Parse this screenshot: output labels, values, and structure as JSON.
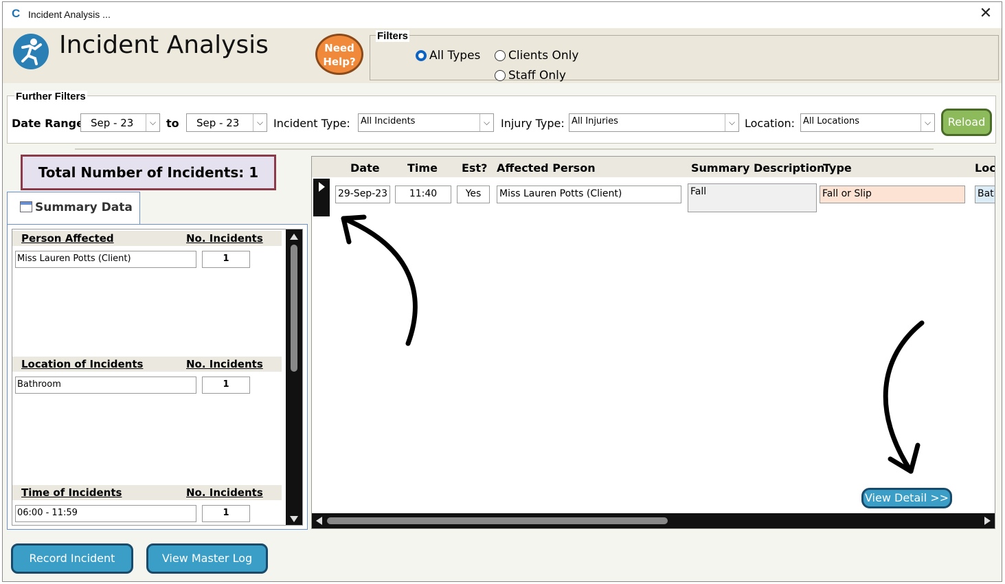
{
  "window": {
    "app_logo": "C",
    "title": "Incident Analysis ...",
    "close_glyph": "✕"
  },
  "header": {
    "icon": "person-falling-icon",
    "title": "Incident Analysis",
    "help_line1": "Need",
    "help_line2": "Help?"
  },
  "filters": {
    "legend": "Filters",
    "options": [
      {
        "label": "All Types",
        "selected": true
      },
      {
        "label": "Clients Only",
        "selected": false
      },
      {
        "label": "Staff Only",
        "selected": false
      }
    ]
  },
  "further_filters": {
    "legend": "Further Filters",
    "date_range_label": "Date Range:",
    "date_from": "Sep - 23",
    "to_label": "to",
    "date_to": "Sep - 23",
    "incident_type_label": "Incident Type:",
    "incident_type": "All Incidents",
    "injury_type_label": "Injury Type:",
    "injury_type": "All Injuries",
    "location_label": "Location:",
    "location": "All Locations",
    "dropdown_glyph": "⌵",
    "reload": "Reload"
  },
  "summary": {
    "total_label": "Total Number of Incidents: 1",
    "tab_label": "Summary Data",
    "sections": [
      {
        "heading": "Person Affected",
        "count_heading": "No. Incidents",
        "value": "Miss Lauren Potts (Client)",
        "count": "1"
      },
      {
        "heading": "Location of Incidents",
        "count_heading": "No. Incidents",
        "value": "Bathroom",
        "count": "1"
      },
      {
        "heading": "Time of Incidents",
        "count_heading": "No. Incidents",
        "value": "06:00 - 11:59",
        "count": "1"
      }
    ]
  },
  "grid": {
    "columns": [
      "Date",
      "Time",
      "Est?",
      "Affected Person",
      "Summary Description",
      "Type",
      "Loca"
    ],
    "rows": [
      {
        "date": "29-Sep-23",
        "time": "11:40",
        "est": "Yes",
        "person": "Miss Lauren Potts (Client)",
        "description": "Fall",
        "type": "Fall or Slip",
        "location": "Bath"
      }
    ],
    "view_detail": "View Detail >>"
  },
  "footer": {
    "record_incident": "Record Incident",
    "view_master_log": "View Master Log"
  },
  "colors": {
    "accent_button": "#3a9ec7",
    "reload_green": "#8dbb5b",
    "help_orange": "#f08a3a",
    "type_cell": "#fde3d4",
    "location_cell": "#dcecf7",
    "total_border": "#8a3a48"
  }
}
